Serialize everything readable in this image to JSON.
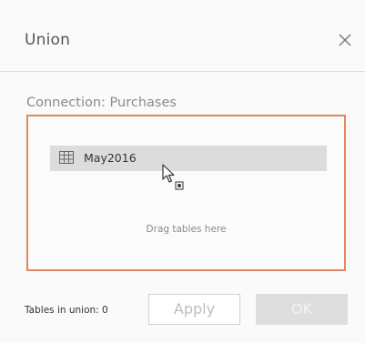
{
  "dialog": {
    "title": "Union",
    "close_icon": "close-icon"
  },
  "connection": {
    "label": "Connection: Purchases"
  },
  "drop_zone": {
    "table_name": "May2016",
    "table_icon": "table-grid-icon",
    "hint": "Drag tables here",
    "cursor_icon": "drag-cursor-icon",
    "border_color": "#e0885e"
  },
  "footer": {
    "tables_in_union": "Tables in union: 0",
    "apply_label": "Apply",
    "ok_label": "OK"
  }
}
